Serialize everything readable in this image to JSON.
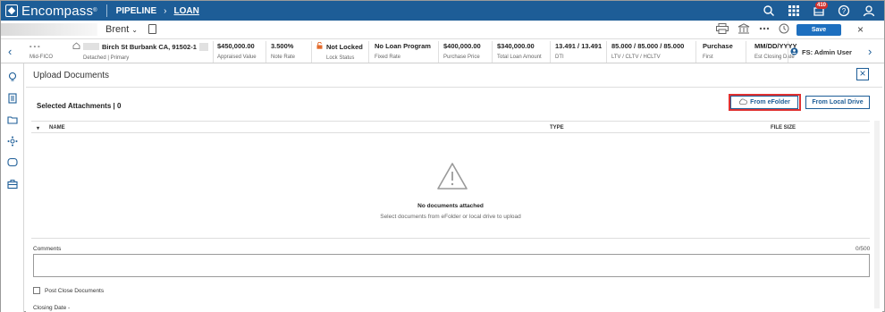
{
  "app": {
    "name": "Encompass",
    "trademark": "®"
  },
  "breadcrumb": {
    "pipeline": "PIPELINE",
    "separator": "›",
    "loan": "LOAN"
  },
  "notifications": {
    "badge_count": "410"
  },
  "loan_header": {
    "borrower_name": "Brent",
    "save_label": "Save",
    "close_label": "×"
  },
  "metrics": [
    {
      "value": "- - -",
      "label": "Mid-FICO"
    },
    {
      "value": "Birch St Burbank CA, 91502-1",
      "label": "Detached | Primary"
    },
    {
      "value": "$450,000.00",
      "label": "Appraised Value"
    },
    {
      "value": "3.500%",
      "label": "Note Rate"
    },
    {
      "value": "Not Locked",
      "label": "Lock Status"
    },
    {
      "value": "No Loan Program",
      "label": "Fixed Rate"
    },
    {
      "value": "$400,000.00",
      "label": "Purchase Price"
    },
    {
      "value": "$340,000.00",
      "label": "Total Loan Amount"
    },
    {
      "value": "13.491 / 13.491",
      "label": "DTI"
    },
    {
      "value": "85.000 / 85.000 / 85.000",
      "label": "LTV / CLTV / HCLTV"
    },
    {
      "value": "Purchase",
      "label": "First"
    },
    {
      "value": "MM/DD/YYYY",
      "label": "Est Closing Date"
    }
  ],
  "admin_user": "FS: Admin User",
  "upload": {
    "title": "Upload Documents",
    "selected_attachments": "Selected Attachments | 0",
    "btn_efolder": "From eFolder",
    "btn_local": "From Local Drive",
    "columns": {
      "name": "NAME",
      "type": "TYPE",
      "size": "FILE SIZE"
    },
    "empty_title": "No documents attached",
    "empty_hint": "Select documents from eFolder or local drive to upload",
    "comments_label": "Comments",
    "comments_value": "",
    "char_count": "0/500",
    "post_close_label": "Post Close Documents",
    "closing_date_label": "Closing Date -"
  },
  "colors": {
    "brand": "#1d5d97",
    "save": "#1d6fbf",
    "highlight": "#e03131"
  }
}
